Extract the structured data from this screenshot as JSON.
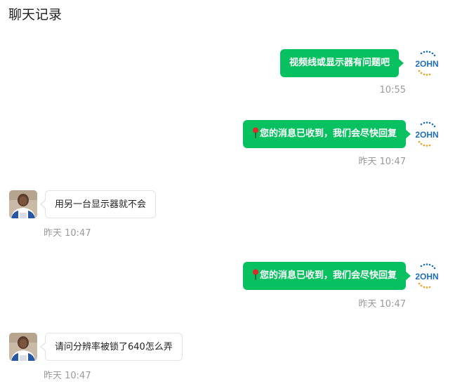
{
  "page": {
    "title": "聊天记录"
  },
  "colors": {
    "accent_green": "#07c160",
    "timestamp_gray": "#9a9a9a",
    "brand_blue": "#1f6fb8",
    "brand_orange": "#f0a01e"
  },
  "brand_logo": {
    "text": "2OHN"
  },
  "messages": [
    {
      "direction": "outgoing",
      "sender": "brand",
      "text": "视频线或显示器有问题吧",
      "pin": false,
      "time": "10:55"
    },
    {
      "direction": "outgoing",
      "sender": "brand",
      "text": "您的消息已收到，我们会尽快回复",
      "pin": true,
      "time": "昨天 10:47"
    },
    {
      "direction": "incoming",
      "sender": "user",
      "text": "用另一台显示器就不会",
      "pin": false,
      "time": "昨天 10:47"
    },
    {
      "direction": "outgoing",
      "sender": "brand",
      "text": "您的消息已收到，我们会尽快回复",
      "pin": true,
      "time": "昨天 10:47"
    },
    {
      "direction": "incoming",
      "sender": "user",
      "text": "请问分辨率被锁了640怎么弄",
      "pin": false,
      "time": "昨天 10:47"
    }
  ]
}
